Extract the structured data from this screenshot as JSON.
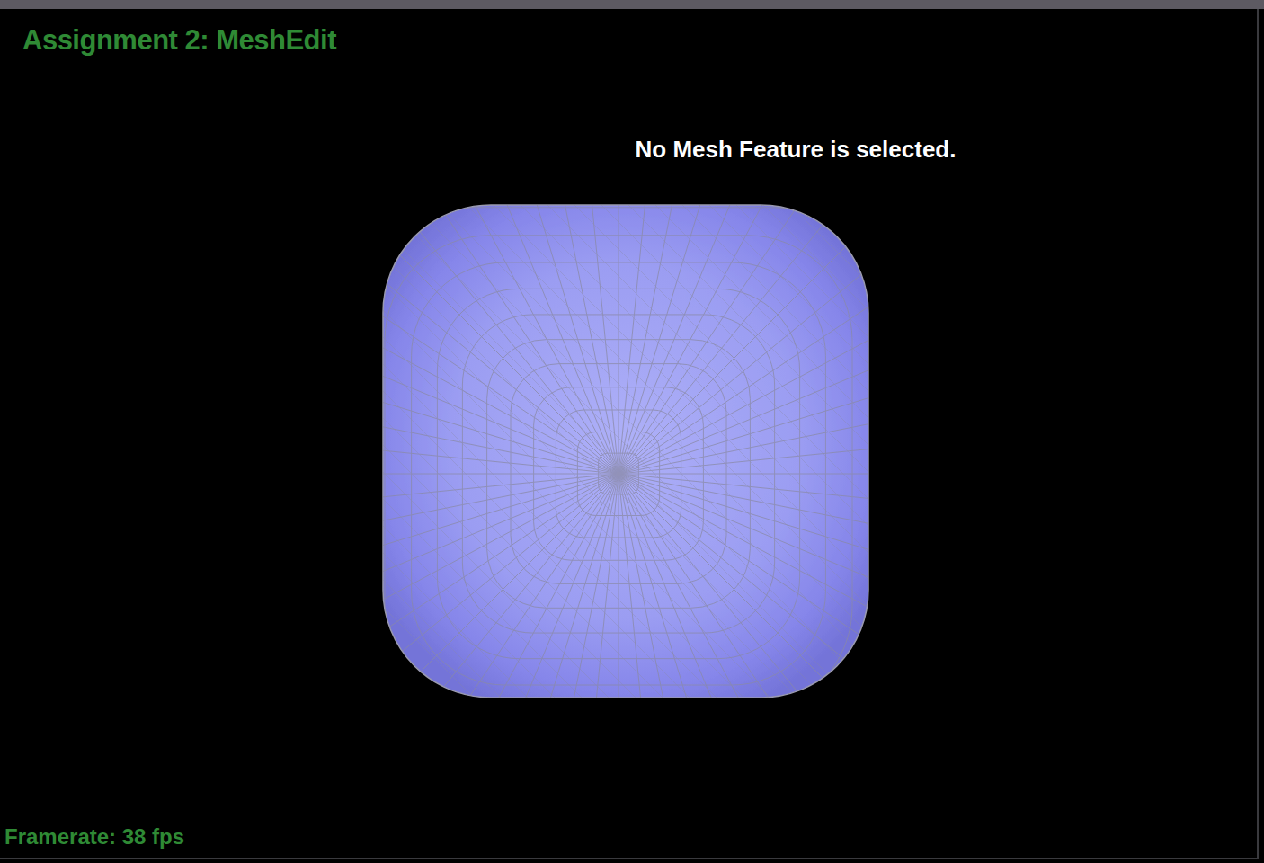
{
  "app": {
    "title": "Assignment 2: MeshEdit"
  },
  "viewport": {
    "selection_message": "No Mesh Feature is selected."
  },
  "status": {
    "framerate": "Framerate: 38 fps"
  }
}
